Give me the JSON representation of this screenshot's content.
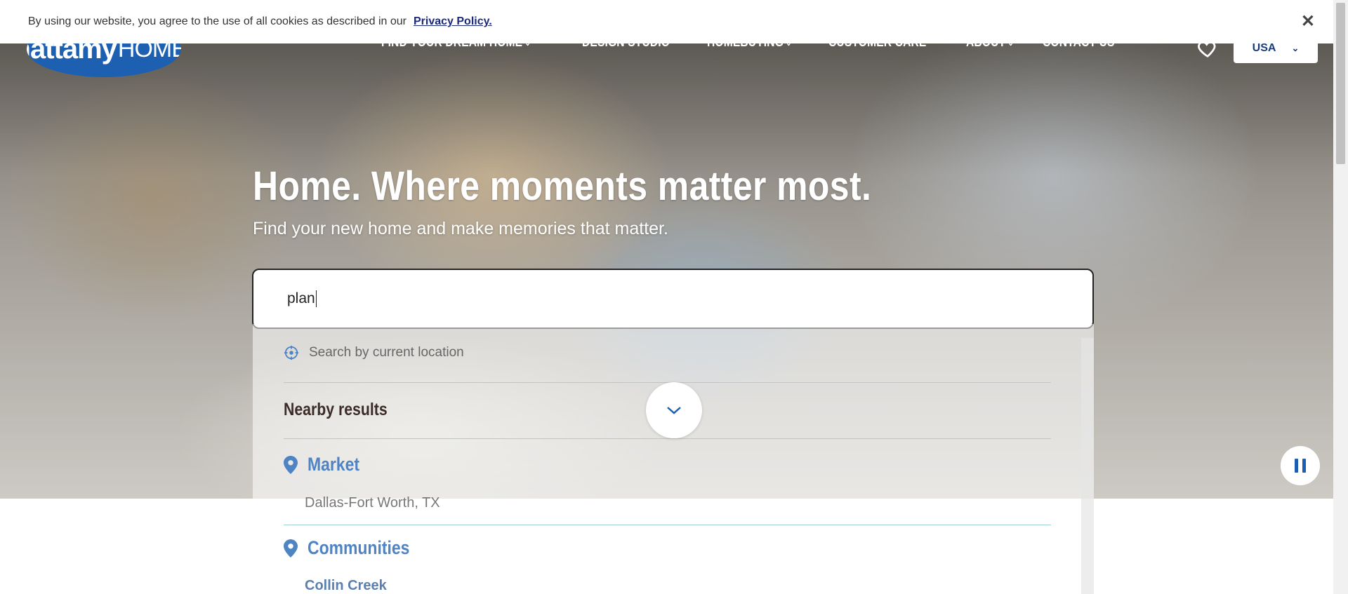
{
  "cookie": {
    "message": "By using our website, you agree to the use of all cookies as described in our",
    "link_label": "Privacy Policy.",
    "close_label": "✕"
  },
  "header": {
    "logo_bold": "mattamy",
    "logo_thin": "HOMES",
    "nav": [
      {
        "label": "Find Your Dream Home",
        "has_dropdown": true
      },
      {
        "label": "Design Studio",
        "has_dropdown": false
      },
      {
        "label": "Homebuying",
        "has_dropdown": true
      },
      {
        "label": "Customer Care",
        "has_dropdown": false
      },
      {
        "label": "About",
        "has_dropdown": true
      },
      {
        "label": "Contact Us",
        "has_dropdown": false
      }
    ],
    "country": "USA"
  },
  "hero": {
    "headline": "Home. Where moments matter most.",
    "subhead": "Find your new home and make memories that matter."
  },
  "search": {
    "value": "plan",
    "current_location_label": "Search by current location",
    "nearby_heading": "Nearby results",
    "sections": [
      {
        "title": "Market",
        "items": [
          "Dallas-Fort Worth, TX"
        ]
      },
      {
        "title": "Communities",
        "items": [
          "Collin Creek"
        ]
      }
    ]
  },
  "colors": {
    "accent_blue": "#1b5eb3",
    "section_blue": "#4f84c4",
    "divider": "#9fd1d6"
  },
  "icons": [
    "heart-icon",
    "chevron-down-icon",
    "location-target-icon",
    "map-pin-icon",
    "pause-icon",
    "close-icon"
  ]
}
